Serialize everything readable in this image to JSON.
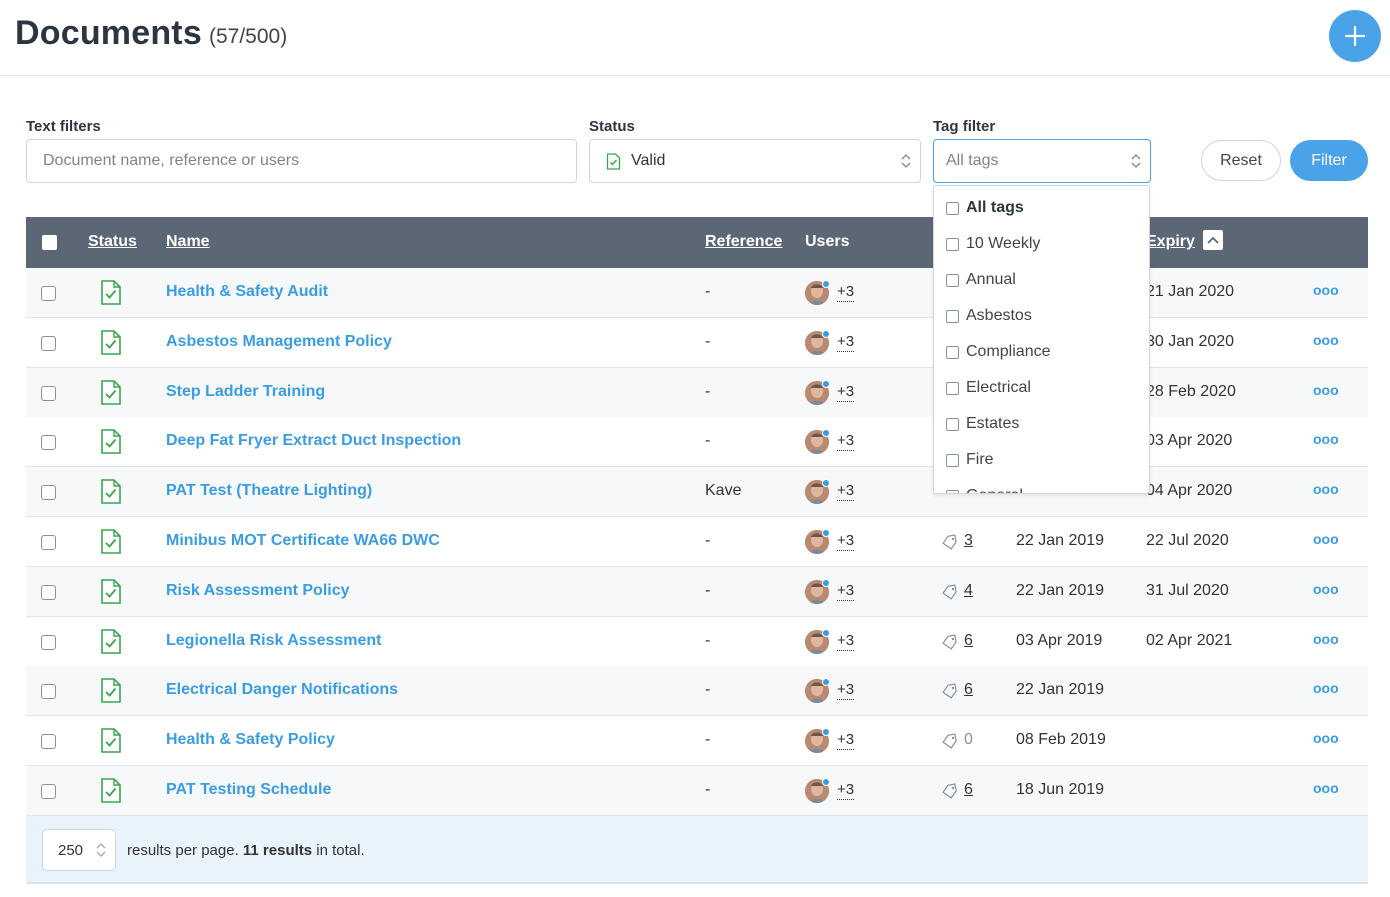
{
  "header": {
    "title": "Documents",
    "count": "(57/500)"
  },
  "filters": {
    "text_label": "Text filters",
    "text_placeholder": "Document name, reference or users",
    "status_label": "Status",
    "status_value": "Valid",
    "tag_label": "Tag filter",
    "tag_value": "All tags",
    "reset_label": "Reset",
    "filter_label": "Filter"
  },
  "table": {
    "columns": {
      "status": "Status",
      "name": "Name",
      "reference": "Reference",
      "users": "Users",
      "expiry": "Expiry"
    },
    "rows": [
      {
        "name": "Health & Safety Audit",
        "reference": "-",
        "users": "+3",
        "tags": "",
        "uploaded": "",
        "expiry": "21 Jan 2020"
      },
      {
        "name": "Asbestos Management Policy",
        "reference": "-",
        "users": "+3",
        "tags": "",
        "uploaded": "",
        "expiry": "30 Jan 2020"
      },
      {
        "name": "Step Ladder Training",
        "reference": "-",
        "users": "+3",
        "tags": "",
        "uploaded": "",
        "expiry": "28 Feb 2020"
      },
      {
        "name": "Deep Fat Fryer Extract Duct Inspection",
        "reference": "-",
        "users": "+3",
        "tags": "",
        "uploaded": "",
        "expiry": "03 Apr 2020"
      },
      {
        "name": "PAT Test (Theatre Lighting)",
        "reference": "Kave",
        "users": "+3",
        "tags": "",
        "uploaded": "",
        "expiry": "04 Apr 2020"
      },
      {
        "name": "Minibus MOT Certificate WA66 DWC",
        "reference": "-",
        "users": "+3",
        "tags": "3",
        "uploaded": "22 Jan 2019",
        "expiry": "22 Jul 2020"
      },
      {
        "name": "Risk Assessment Policy",
        "reference": "-",
        "users": "+3",
        "tags": "4",
        "uploaded": "22 Jan 2019",
        "expiry": "31 Jul 2020"
      },
      {
        "name": "Legionella Risk Assessment",
        "reference": "-",
        "users": "+3",
        "tags": "6",
        "uploaded": "03 Apr 2019",
        "expiry": "02 Apr 2021"
      },
      {
        "name": "Electrical Danger Notifications",
        "reference": "-",
        "users": "+3",
        "tags": "6",
        "uploaded": "22 Jan 2019",
        "expiry": ""
      },
      {
        "name": "Health & Safety Policy",
        "reference": "-",
        "users": "+3",
        "tags": "0",
        "uploaded": "08 Feb 2019",
        "expiry": ""
      },
      {
        "name": "PAT Testing Schedule",
        "reference": "-",
        "users": "+3",
        "tags": "6",
        "uploaded": "18 Jun 2019",
        "expiry": ""
      }
    ],
    "more_label": "ooo"
  },
  "footer": {
    "per_page": "250",
    "text_before": "results per page. ",
    "text_bold": "11 results",
    "text_after": " in total."
  },
  "tag_dropdown": {
    "options": [
      "All tags",
      "10 Weekly",
      "Annual",
      "Asbestos",
      "Compliance",
      "Electrical",
      "Estates",
      "Fire",
      "General"
    ]
  },
  "colors": {
    "accent": "#4aa3e8",
    "header_bg": "#5c6776",
    "valid_green": "#3aa64f"
  },
  "icons": {
    "status": "document-check-icon",
    "tag": "tag-icon",
    "add": "plus-icon"
  }
}
